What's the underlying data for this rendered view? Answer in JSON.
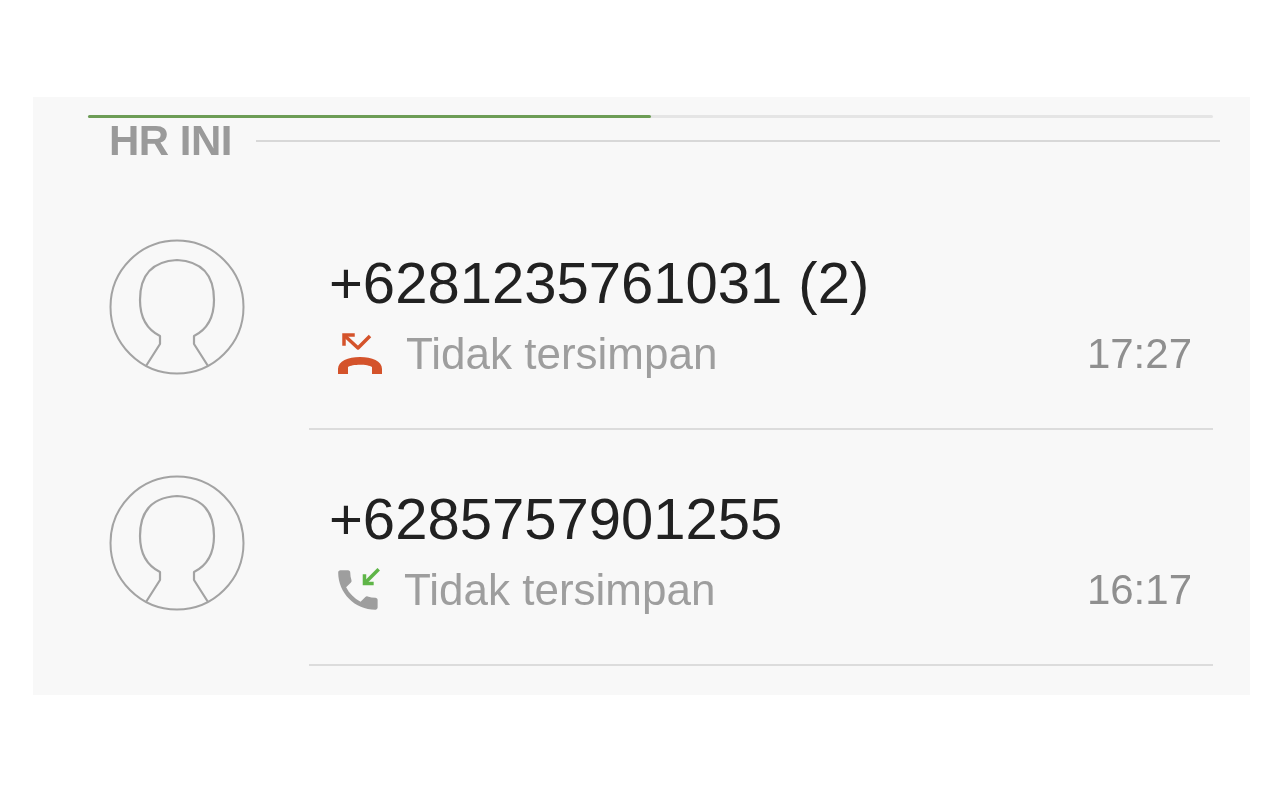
{
  "progress": {
    "level": 0.5
  },
  "section": {
    "title": "HR INI"
  },
  "calls": [
    {
      "number": "+6281235761031 (2)",
      "kind": "missed",
      "status": "Tidak tersimpan",
      "time": "17:27"
    },
    {
      "number": "+6285757901255",
      "kind": "incoming",
      "status": "Tidak tersimpan",
      "time": "16:17"
    }
  ]
}
